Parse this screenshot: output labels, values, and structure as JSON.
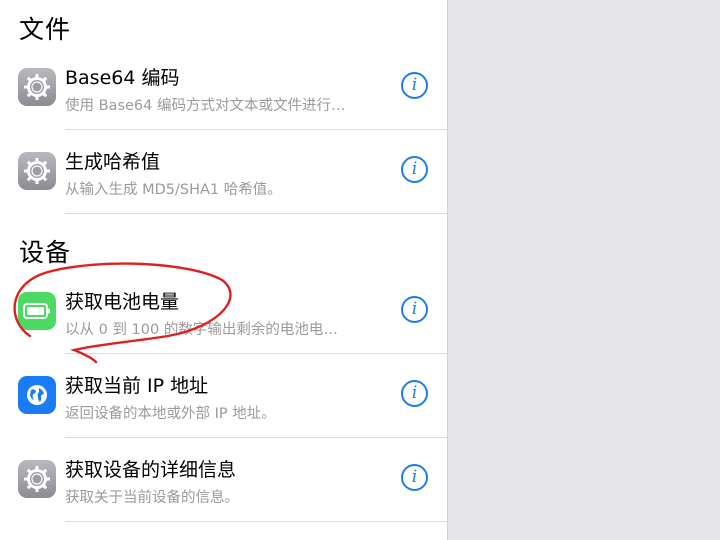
{
  "sections": [
    {
      "header": "文件",
      "rows": [
        {
          "icon": "gear-icon",
          "title": "Base64 编码",
          "subtitle": "使用 Base64 编码方式对文本或文件进行…"
        },
        {
          "icon": "gear-icon",
          "title": "生成哈希值",
          "subtitle": "从输入生成 MD5/SHA1 哈希值。"
        }
      ]
    },
    {
      "header": "设备",
      "rows": [
        {
          "icon": "battery-icon",
          "title": "获取电池电量",
          "subtitle": "以从 0 到 100 的数字输出剩余的电池电…"
        },
        {
          "icon": "globe-icon",
          "title": "获取当前 IP 地址",
          "subtitle": "返回设备的本地或外部 IP 地址。"
        },
        {
          "icon": "gear-icon",
          "title": "获取设备的详细信息",
          "subtitle": "获取关于当前设备的信息。"
        }
      ]
    }
  ],
  "info_glyph": "i",
  "colors": {
    "accent": "#1a7cf5",
    "battery": "#4cd964",
    "annotation": "#e02020"
  }
}
